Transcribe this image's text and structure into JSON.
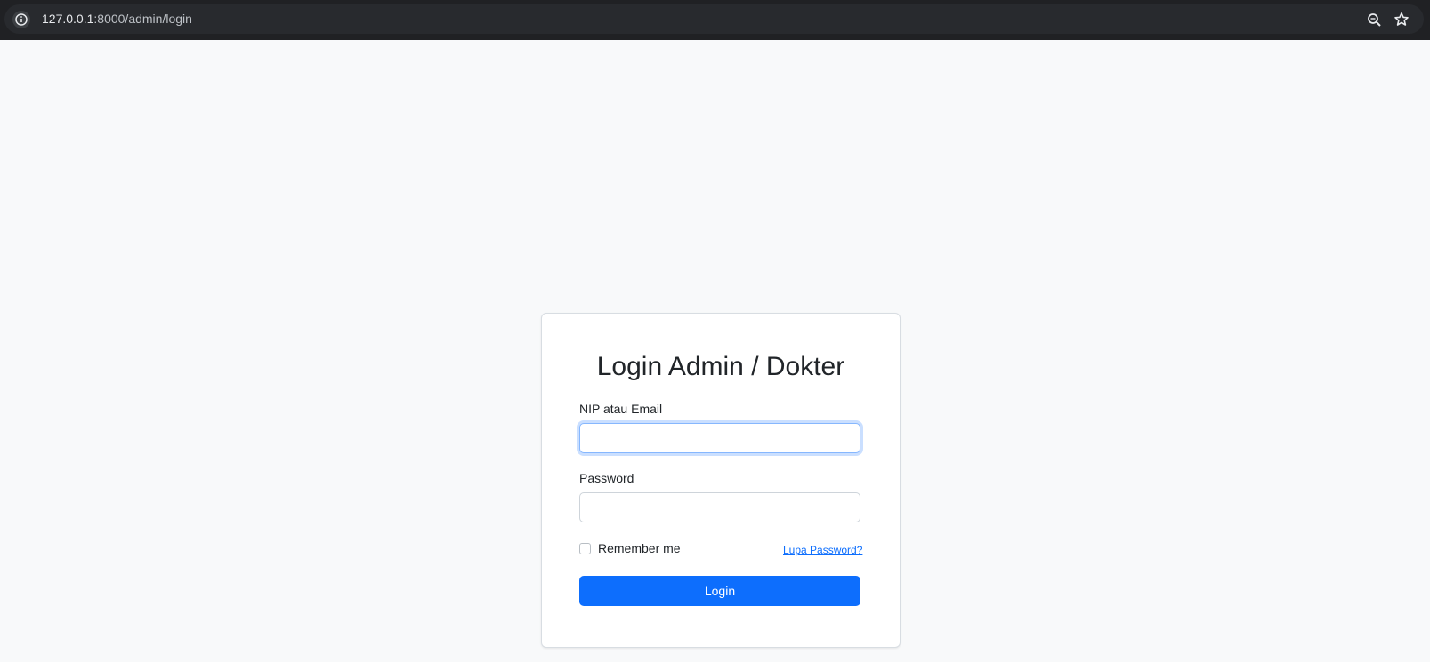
{
  "browser": {
    "url_host": "127.0.0.1",
    "url_path": ":8000/admin/login",
    "icons": {
      "site_info": "info-icon",
      "zoom": "zoom-icon",
      "bookmark": "star-icon"
    }
  },
  "login": {
    "title": "Login Admin / Dokter",
    "nip_email_label": "NIP atau Email",
    "nip_email_value": "",
    "password_label": "Password",
    "password_value": "",
    "remember_label": "Remember me",
    "forgot_password_label": "Lupa Password?",
    "login_button_label": "Login"
  },
  "colors": {
    "browser_background": "#202124",
    "page_background": "#f8f9fa",
    "primary": "#0d6efd",
    "focus_border": "#86b7fe"
  }
}
